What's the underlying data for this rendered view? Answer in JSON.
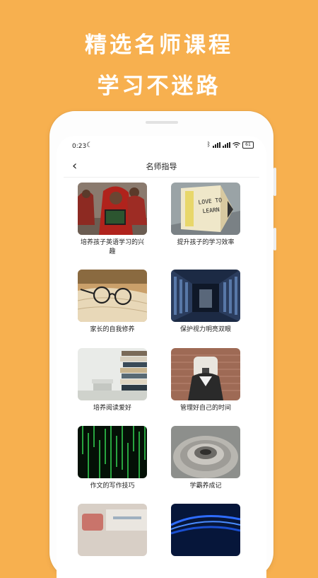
{
  "promo": {
    "line1": "精选名师课程",
    "line2": "学习不迷路"
  },
  "status_bar": {
    "time": "0:23",
    "battery": "61"
  },
  "nav": {
    "title": "名师指导"
  },
  "courses": [
    {
      "title": "培养孩子英语学习的兴趣"
    },
    {
      "title": "提升孩子的学习效率"
    },
    {
      "title": "家长的自我修养"
    },
    {
      "title": "保护视力明亮双眼"
    },
    {
      "title": "培养阅读爱好"
    },
    {
      "title": "管理好自己的时间"
    },
    {
      "title": "作文的写作技巧"
    },
    {
      "title": "学霸养成记"
    },
    {
      "title": ""
    },
    {
      "title": ""
    }
  ],
  "thumb_text": {
    "love_to_learn": "LOVE TO LEARN"
  },
  "colors": {
    "background": "#F7B04F",
    "headline": "#FFFFFF"
  }
}
